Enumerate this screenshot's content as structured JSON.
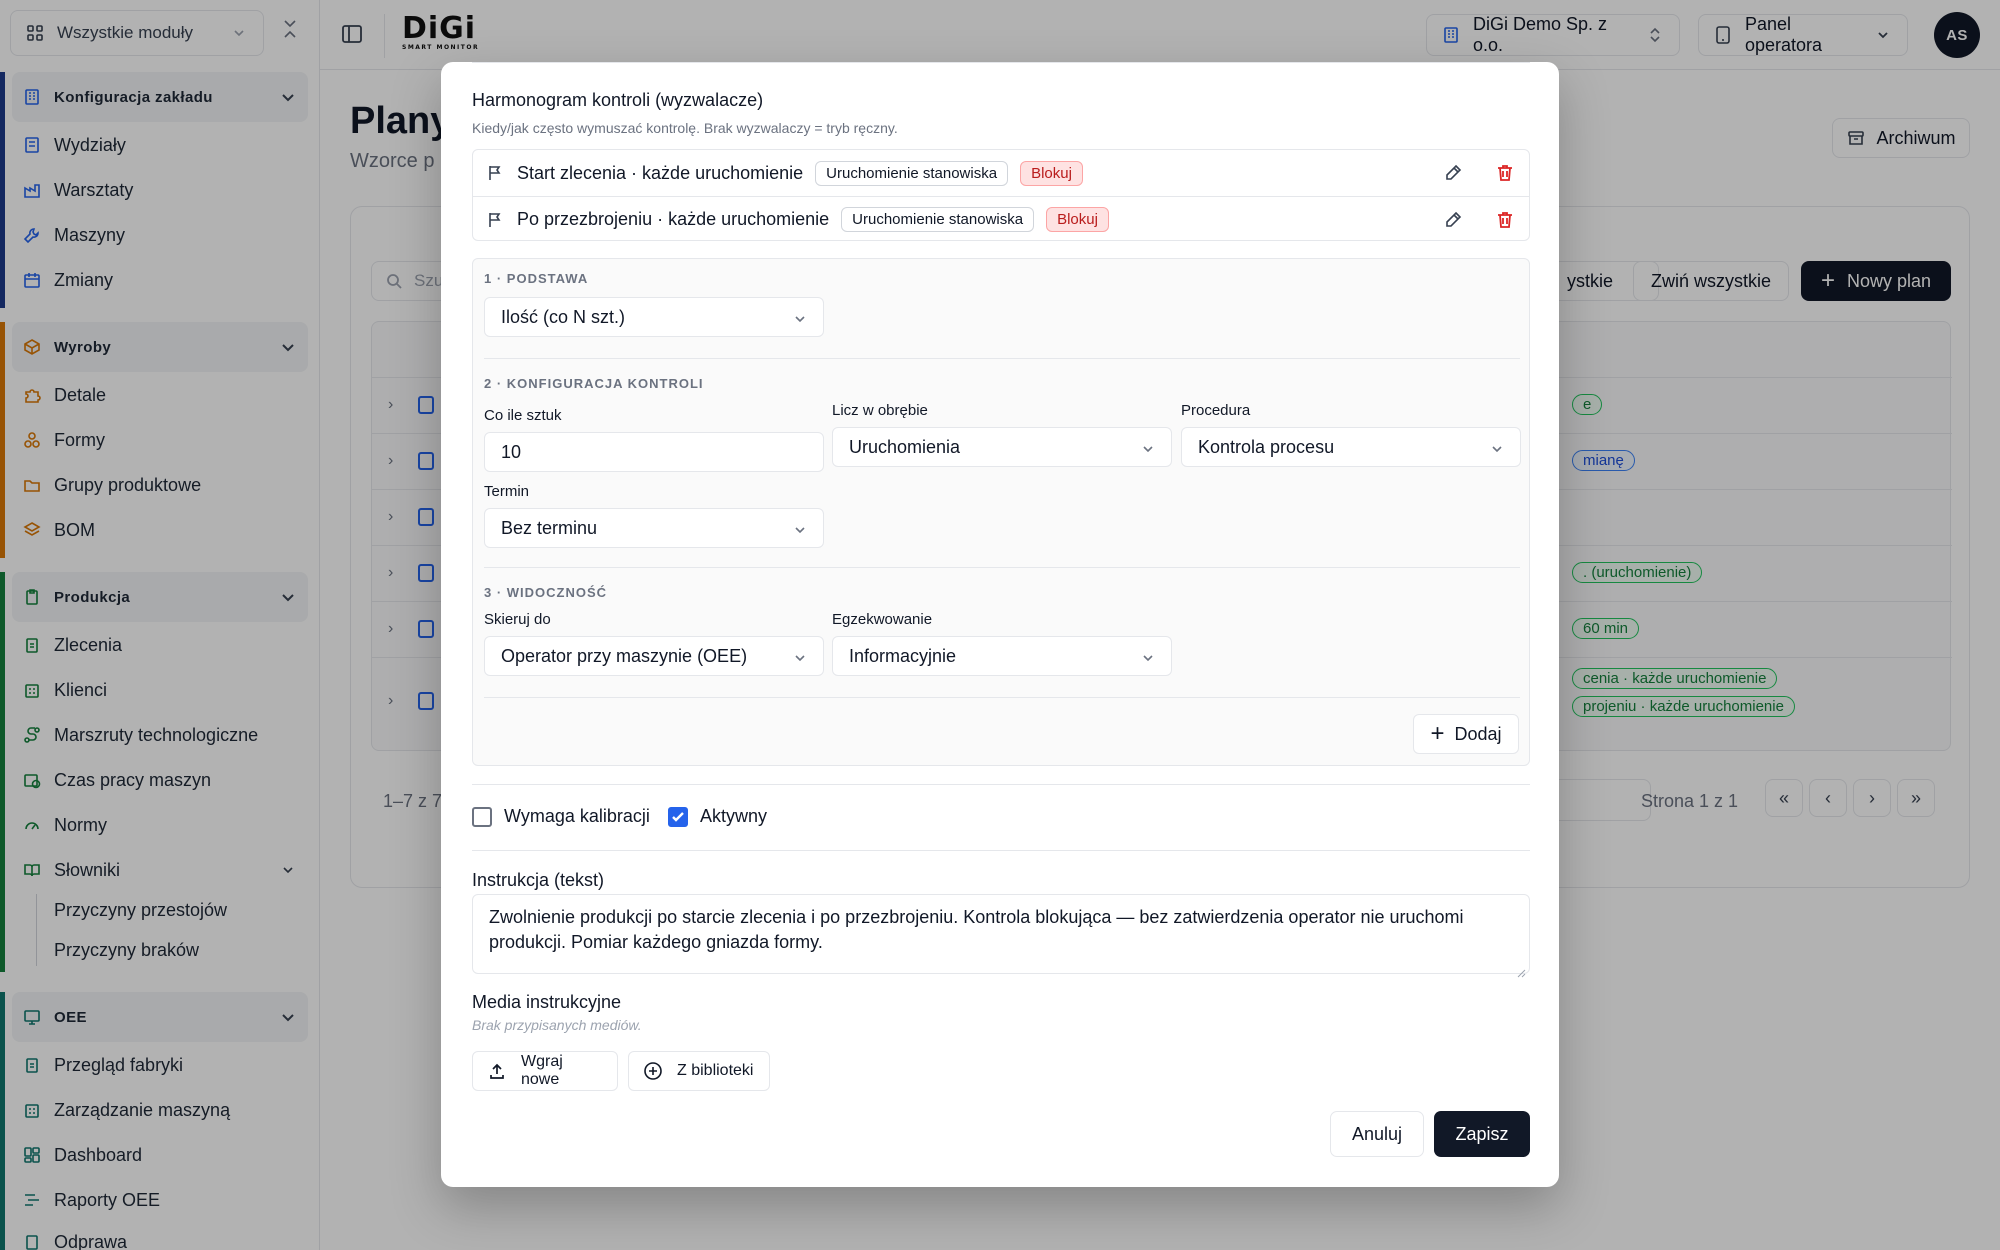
{
  "sidebar": {
    "module_select": "Wszystkie moduły",
    "groups": [
      {
        "title": "Konfiguracja zakładu",
        "items": [
          "Wydziały",
          "Warsztaty",
          "Maszyny",
          "Zmiany"
        ]
      },
      {
        "title": "Wyroby",
        "items": [
          "Detale",
          "Formy",
          "Grupy produktowe",
          "BOM"
        ]
      },
      {
        "title": "Produkcja",
        "items": [
          "Zlecenia",
          "Klienci",
          "Marszruty technologiczne",
          "Czas pracy maszyn",
          "Normy",
          "Słowniki"
        ],
        "subitems": [
          "Przyczyny przestojów",
          "Przyczyny braków"
        ]
      },
      {
        "title": "OEE",
        "items": [
          "Przegląd fabryki",
          "Zarządzanie maszyną",
          "Dashboard",
          "Raporty OEE",
          "Odprawa"
        ]
      }
    ]
  },
  "topbar": {
    "logo": "DiGi",
    "logo_sub": "SMART MONITOR",
    "company": "DiGi Demo Sp. z o.o.",
    "panel": "Panel operatora",
    "avatar": "AS"
  },
  "page": {
    "title": "Plany",
    "subtitle": "Wzorce p",
    "archive": "Archiwum",
    "search_placeholder": "Szu",
    "expand_all": "ystkie",
    "collapse_all": "Zwiń wszystkie",
    "new_plan": "Nowy plan",
    "row_tags": [
      "e",
      "mianę",
      ". (uruchomienie)",
      "60 min",
      "cenia · każde uruchomienie",
      "projeniu · każde uruchomienie"
    ],
    "count": "1–7 z 7",
    "page_label": "Strona 1 z 1"
  },
  "modal": {
    "schedule_title": "Harmonogram kontroli (wyzwalacze)",
    "schedule_desc": "Kiedy/jak często wymuszać kontrolę. Brak wyzwalaczy = tryb ręczny.",
    "triggers": [
      {
        "label": "Start zlecenia · każde uruchomienie",
        "badge": "Uruchomienie stanowiska",
        "block": "Blokuj"
      },
      {
        "label": "Po przezbrojeniu · każde uruchomienie",
        "badge": "Uruchomienie stanowiska",
        "block": "Blokuj"
      }
    ],
    "step1": "1 · PODSTAWA",
    "basis": "Ilość (co N szt.)",
    "step2": "2 · KONFIGURACJA KONTROLI",
    "every_label": "Co ile sztuk",
    "every_value": "10",
    "count_in_label": "Licz w obrębie",
    "count_in_value": "Uruchomienia",
    "procedure_label": "Procedura",
    "procedure_value": "Kontrola procesu",
    "deadline_label": "Termin",
    "deadline_value": "Bez terminu",
    "step3": "3 · WIDOCZNOŚĆ",
    "target_label": "Skieruj do",
    "target_value": "Operator przy maszynie (OEE)",
    "enforce_label": "Egzekwowanie",
    "enforce_value": "Informacyjnie",
    "add": "Dodaj",
    "calib_label": "Wymaga kalibracji",
    "calib_checked": false,
    "active_label": "Aktywny",
    "active_checked": true,
    "instruction_label": "Instrukcja (tekst)",
    "instruction_text": "Zwolnienie produkcji po starcie zlecenia i po przezbrojeniu. Kontrola blokująca — bez zatwierdzenia operator nie uruchomi produkcji. Pomiar każdego gniazda formy.",
    "media_label": "Media instrukcyjne",
    "media_empty": "Brak przypisanych mediów.",
    "upload": "Wgraj nowe",
    "library": "Z biblioteki",
    "cancel": "Anuluj",
    "save": "Zapisz"
  },
  "colors": {
    "dark": "#111827",
    "accent": "#2563eb",
    "danger": "#dc2626",
    "rail_green": "#15803d",
    "rail_blue": "#1e3a8a"
  }
}
